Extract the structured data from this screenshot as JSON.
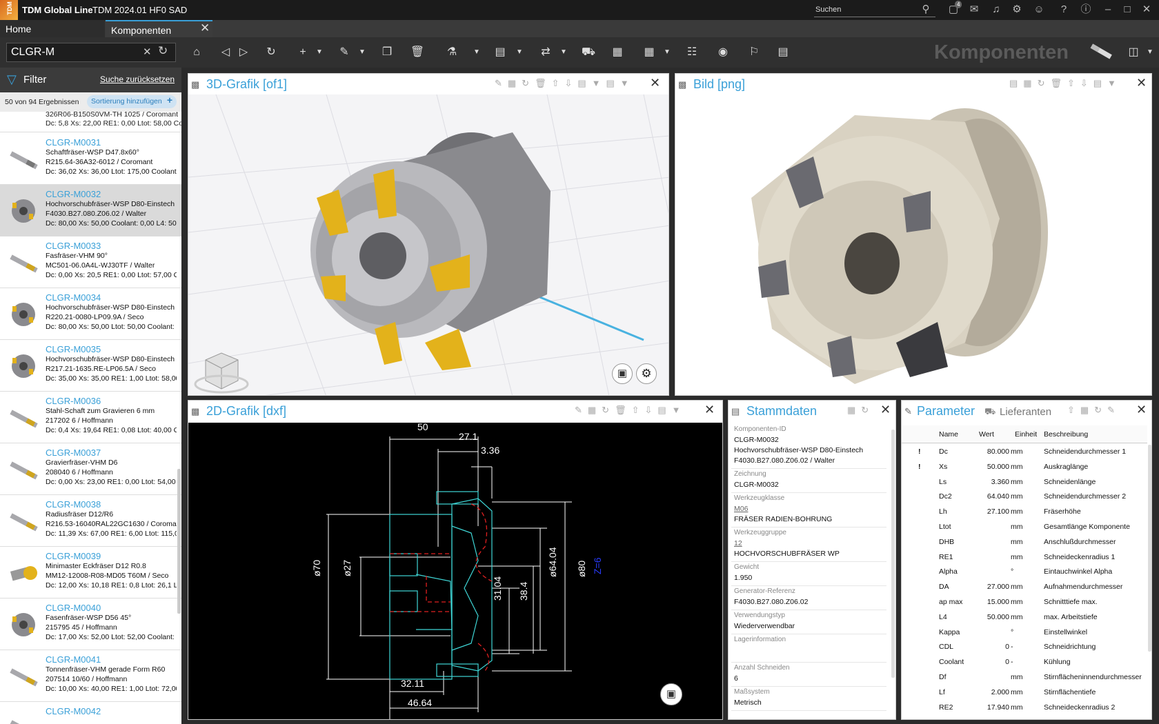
{
  "window": {
    "logo": "TDM",
    "app_title": "TDM Global Line",
    "version": "TDM 2024.01 HF0 SAD",
    "search_placeholder": "Suchen",
    "notif_count": "4"
  },
  "tabs": [
    {
      "label": "Home"
    },
    {
      "label": "Komponenten"
    }
  ],
  "toolbar": {
    "search_value": "CLGR-M",
    "module_title": "Komponenten"
  },
  "left": {
    "filter_label": "Filter",
    "reset_label": "Suche zurücksetzen",
    "results": "50 von 94 Ergebnissen",
    "sort_label": "Sortierung hinzufügen",
    "partial_top": [
      "326R06-B150S0VM-TH 1025 / Coromant",
      "Dc: 5,8 Xs: 22,00 RE1: 0,00 Ltot: 58,00 Coo"
    ],
    "items": [
      {
        "id": "CLGR-M0031",
        "l1": "Schaftfräser-WSP D47.8x60°",
        "l2": "R215.64-36A32-6012 / Coromant",
        "l3": "Dc: 36,02 Xs: 36,00 Ltot: 175,00 Coolant: 0"
      },
      {
        "id": "CLGR-M0032",
        "l1": "Hochvorschubfräser-WSP D80-Einstech",
        "l2": "F4030.B27.080.Z06.02 / Walter",
        "l3": "Dc: 80,00 Xs: 50,00 Coolant: 0,00 L4: 50,00"
      },
      {
        "id": "CLGR-M0033",
        "l1": "Fasfräser-VHM 90°",
        "l2": "MC501-06.0A4L-WJ30TF / Walter",
        "l3": "Dc: 0,00 Xs: 20,5 RE1: 0,00 Ltot: 57,00 Coo"
      },
      {
        "id": "CLGR-M0034",
        "l1": "Hochvorschubfräser-WSP D80-Einstech",
        "l2": "R220.21-0080-LP09.9A / Seco",
        "l3": "Dc: 80,00 Xs: 50,00 Ltot: 50,00 Coolant: 0,0"
      },
      {
        "id": "CLGR-M0035",
        "l1": "Hochvorschubfräser-WSP D80-Einstech",
        "l2": "R217.21-1635.RE-LP06.5A / Seco",
        "l3": "Dc: 35,00 Xs: 35,00 RE1: 1,00 Ltot: 58,00 Cc"
      },
      {
        "id": "CLGR-M0036",
        "l1": "Stahl-Schaft zum Gravieren 6 mm",
        "l2": "217202 6 / Hoffmann",
        "l3": "Dc: 0,4 Xs: 19,64 RE1: 0,08 Ltot: 40,00 Coo"
      },
      {
        "id": "CLGR-M0037",
        "l1": "Gravierfräser-VHM D6",
        "l2": "208040 6 / Hoffmann",
        "l3": "Dc: 0,00 Xs: 23,00 RE1: 0,00 Ltot: 54,00 Co"
      },
      {
        "id": "CLGR-M0038",
        "l1": "Radiusfräser D12/R6",
        "l2": "R216.53-16040RAL22GC1630 / Coromant",
        "l3": "Dc: 11,39 Xs: 67,00 RE1: 6,00 Ltot: 115,00 C"
      },
      {
        "id": "CLGR-M0039",
        "l1": "Minimaster Eckfräser D12 R0.8",
        "l2": "MM12-12008-R08-MD05 T60M / Seco",
        "l3": "Dc: 12,00 Xs: 10,18 RE1: 0,8 Ltot: 26,1 L4: 1"
      },
      {
        "id": "CLGR-M0040",
        "l1": "Fasenfräser-WSP D56 45°",
        "l2": "215795 45 / Hoffmann",
        "l3": "Dc: 17,00 Xs: 52,00 Ltot: 52,00 Coolant: 1,0"
      },
      {
        "id": "CLGR-M0041",
        "l1": "Tonnenfräser-VHM gerade Form R60",
        "l2": "207514 10/60 / Hoffmann",
        "l3": "Dc: 10,00 Xs: 40,00 RE1: 1,00 Ltot: 72,00 Cc"
      },
      {
        "id": "CLGR-M0042",
        "l1": "",
        "l2": "",
        "l3": ""
      }
    ]
  },
  "panels": {
    "grafik3d": "3D-Grafik [of1]",
    "bild": "Bild [png]",
    "grafik2d": "2D-Grafik [dxf]",
    "stammdaten": "Stammdaten",
    "parameter": "Parameter",
    "lieferanten": "Lieferanten"
  },
  "drawing": {
    "dims": [
      "50",
      "27.1",
      "3.36",
      "ø70",
      "ø27",
      "31.04",
      "38.4",
      "ø64.04",
      "ø80",
      "32.11",
      "46.64",
      "Z=6"
    ]
  },
  "stammdaten": [
    {
      "label": "Komponenten-ID",
      "values": [
        "CLGR-M0032",
        "Hochvorschubfräser-WSP D80-Einstech",
        "F4030.B27.080.Z06.02 / Walter"
      ]
    },
    {
      "label": "Zeichnung",
      "values": [
        "CLGR-M0032"
      ]
    },
    {
      "label": "Werkzeugklasse",
      "values": [
        "M06",
        "FRÄSER RADIEN-BOHRUNG"
      ]
    },
    {
      "label": "Werkzeuggruppe",
      "values": [
        "12",
        "HOCHVORSCHUBFRÄSER WP"
      ]
    },
    {
      "label": "Gewicht",
      "values": [
        "1.950"
      ]
    },
    {
      "label": "Generator-Referenz",
      "values": [
        "F4030.B27.080.Z06.02"
      ]
    },
    {
      "label": "Verwendungstyp",
      "values": [
        "Wiederverwendbar"
      ]
    },
    {
      "label": "Lagerinformation",
      "values": [
        ""
      ]
    },
    {
      "label": "Anzahl Schneiden",
      "values": [
        "6"
      ]
    },
    {
      "label": "Maßsystem",
      "values": [
        "Metrisch"
      ]
    }
  ],
  "params": {
    "headers": [
      "Name",
      "Wert",
      "Einheit",
      "Beschreibung"
    ],
    "rows": [
      {
        "flag": "!",
        "name": "Dc",
        "value": "80.000",
        "unit": "mm",
        "desc": "Schneidendurchmesser 1"
      },
      {
        "flag": "!",
        "name": "Xs",
        "value": "50.000",
        "unit": "mm",
        "desc": "Auskraglänge"
      },
      {
        "flag": "",
        "name": "Ls",
        "value": "3.360",
        "unit": "mm",
        "desc": "Schneidenlänge"
      },
      {
        "flag": "",
        "name": "Dc2",
        "value": "64.040",
        "unit": "mm",
        "desc": "Schneidendurchmesser 2"
      },
      {
        "flag": "",
        "name": "Lh",
        "value": "27.100",
        "unit": "mm",
        "desc": "Fräserhöhe"
      },
      {
        "flag": "",
        "name": "Ltot",
        "value": "",
        "unit": "mm",
        "desc": "Gesamtlänge Komponente"
      },
      {
        "flag": "",
        "name": "DHB",
        "value": "",
        "unit": "mm",
        "desc": "Anschlußdurchmesser"
      },
      {
        "flag": "",
        "name": "RE1",
        "value": "",
        "unit": "mm",
        "desc": "Schneideckenradius 1"
      },
      {
        "flag": "",
        "name": "Alpha",
        "value": "",
        "unit": "°",
        "desc": "Eintauchwinkel Alpha"
      },
      {
        "flag": "",
        "name": "DA",
        "value": "27.000",
        "unit": "mm",
        "desc": "Aufnahmendurchmesser"
      },
      {
        "flag": "",
        "name": "ap max",
        "value": "15.000",
        "unit": "mm",
        "desc": "Schnitttiefe max."
      },
      {
        "flag": "",
        "name": "L4",
        "value": "50.000",
        "unit": "mm",
        "desc": "max. Arbeitstiefe"
      },
      {
        "flag": "",
        "name": "Kappa",
        "value": "",
        "unit": "°",
        "desc": "Einstellwinkel"
      },
      {
        "flag": "",
        "name": "CDL",
        "value": "0",
        "unit": "-",
        "desc": "Schneidrichtung"
      },
      {
        "flag": "",
        "name": "Coolant",
        "value": "0",
        "unit": "-",
        "desc": "Kühlung"
      },
      {
        "flag": "",
        "name": "Df",
        "value": "",
        "unit": "mm",
        "desc": "Stirnflächeninnendurchmesser"
      },
      {
        "flag": "",
        "name": "Lf",
        "value": "2.000",
        "unit": "mm",
        "desc": "Stirnflächentiefe"
      },
      {
        "flag": "",
        "name": "RE2",
        "value": "17.940",
        "unit": "mm",
        "desc": "Schneideckenradius 2"
      }
    ]
  }
}
